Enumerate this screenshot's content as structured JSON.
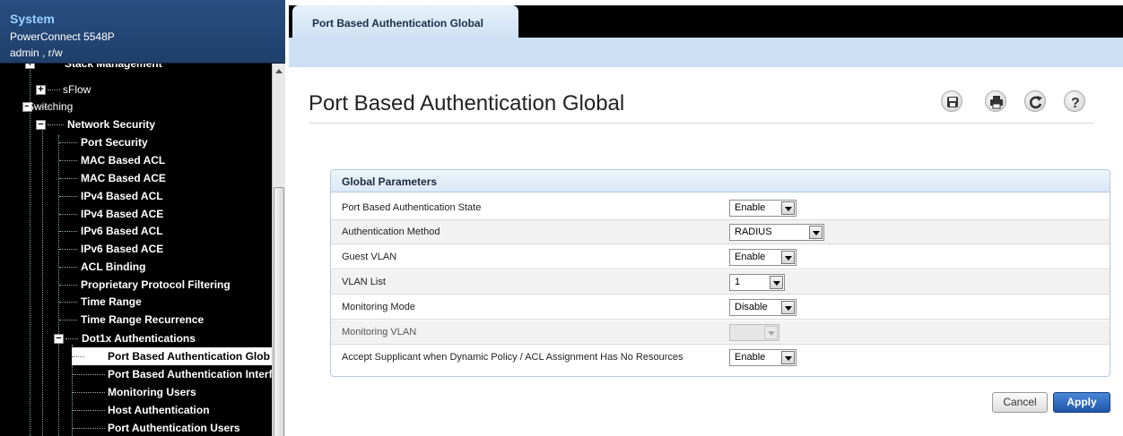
{
  "system": {
    "title": "System",
    "device": "PowerConnect 5548P",
    "user": "admin , r/w"
  },
  "tree": {
    "items": [
      {
        "label": "Stack Management",
        "expander": "+"
      },
      {
        "label": "sFlow",
        "expander": "+"
      },
      {
        "label": "Switching",
        "expander": "-"
      },
      {
        "label": "Network Security",
        "expander": "-"
      },
      {
        "label": "Port Security"
      },
      {
        "label": "MAC Based ACL"
      },
      {
        "label": "MAC Based ACE"
      },
      {
        "label": "IPv4 Based ACL"
      },
      {
        "label": "IPv4 Based ACE"
      },
      {
        "label": "IPv6 Based ACL"
      },
      {
        "label": "IPv6 Based ACE"
      },
      {
        "label": "ACL Binding"
      },
      {
        "label": "Proprietary Protocol Filtering"
      },
      {
        "label": "Time Range"
      },
      {
        "label": "Time Range Recurrence"
      },
      {
        "label": "Dot1x Authentications",
        "expander": "-"
      },
      {
        "label": "Port Based Authentication Glob",
        "selected": true
      },
      {
        "label": "Port Based Authentication Interfa"
      },
      {
        "label": "Monitoring Users"
      },
      {
        "label": "Host Authentication"
      },
      {
        "label": "Port Authentication Users"
      }
    ]
  },
  "tab": {
    "label": "Port Based Authentication Global"
  },
  "page": {
    "title": "Port Based Authentication Global"
  },
  "toolbar": {
    "icons": [
      "save-icon",
      "print-icon",
      "refresh-icon",
      "help-icon"
    ]
  },
  "panel": {
    "title": "Global Parameters",
    "rows": [
      {
        "label": "Port Based Authentication State",
        "value": "Enable"
      },
      {
        "label": "Authentication Method",
        "value": "RADIUS"
      },
      {
        "label": "Guest VLAN",
        "value": "Enable"
      },
      {
        "label": "VLAN List",
        "value": "1"
      },
      {
        "label": "Monitoring Mode",
        "value": "Disable"
      },
      {
        "label": "Monitoring VLAN",
        "value": "",
        "disabled": true
      },
      {
        "label": "Accept Supplicant when Dynamic Policy / ACL Assignment Has No Resources",
        "value": "Enable"
      }
    ]
  },
  "buttons": {
    "cancel": "Cancel",
    "apply": "Apply"
  },
  "colors": {
    "accent": "#2a62b8",
    "band": "#cde0f3",
    "nav_bg": "#000000",
    "header_bg": "#284f80"
  }
}
